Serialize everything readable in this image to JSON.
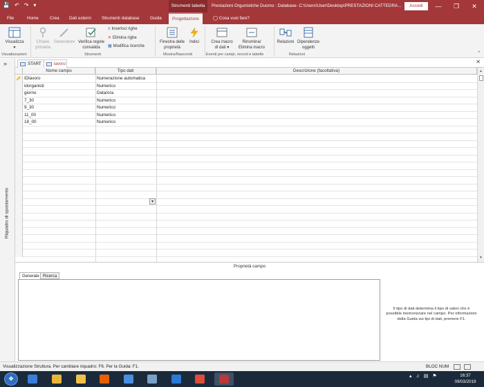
{
  "titlebar": {
    "qat_icons": [
      "save-icon",
      "undo-icon",
      "redo-icon",
      "customize-icon"
    ],
    "context_label": "Strumenti tabella",
    "title": "Prestazioni Orgunistiche Duomo : Database- C:\\Users\\User\\Desktop\\PRESTAZIONI CATTEDRA...",
    "login": "Accedi",
    "controls": [
      "?",
      "—",
      "❐",
      "✕"
    ]
  },
  "ribbon_tabs": {
    "items": [
      "File",
      "Home",
      "Crea",
      "Dati esterni",
      "Strumenti database",
      "Guida",
      "Progettazione"
    ],
    "active": "Progettazione",
    "tell_me": "Cosa vuoi fare?"
  },
  "ribbon": {
    "visualizza": {
      "label": "Visualizza"
    },
    "chiave_primaria": {
      "label_1": "Chiave",
      "label_2": "primaria"
    },
    "generatore": {
      "label": "Generatore"
    },
    "verifica": {
      "label_1": "Verifica regole",
      "label_2": "convalida"
    },
    "inserisci_righe": "Inserisci righe",
    "elimina_righe": "Elimina righe",
    "modifica_ricerche": "Modifica ricerche",
    "finestra": {
      "label_1": "Finestra delle",
      "label_2": "proprietà"
    },
    "indici": {
      "label": "Indici"
    },
    "crea_macro": {
      "label_1": "Crea macro",
      "label_2": "di dati ▾"
    },
    "rinomina": {
      "label_1": "Rinomina/",
      "label_2": "Elimina macro"
    },
    "relazioni": {
      "label": "Relazioni"
    },
    "dipendenze": {
      "label_1": "Dipendenze",
      "label_2": "oggetti"
    },
    "groups": {
      "visualizzazioni": "Visualizzazioni",
      "strumenti": "Strumenti",
      "mostra": "Mostra/Nascondi",
      "eventi": "Eventi per campi, record e tabelle",
      "relazioni": "Relazioni"
    }
  },
  "nav_pane": {
    "label": "Riquadro di spostamento",
    "toggle": "»"
  },
  "doc_tabs": [
    {
      "label": "START"
    },
    {
      "label": "lavoro"
    }
  ],
  "grid": {
    "headers": {
      "nome": "Nome campo",
      "tipo": "Tipo dati",
      "descrizione": "Descrizione (facoltativa)"
    },
    "rows": [
      {
        "key": true,
        "nome": "IDlavoro",
        "tipo": "Numerazione automatica"
      },
      {
        "key": false,
        "nome": "idorganisti",
        "tipo": "Numerico"
      },
      {
        "key": false,
        "nome": "giorno",
        "tipo": "Data/ora"
      },
      {
        "key": false,
        "nome": "7_30",
        "tipo": "Numerico"
      },
      {
        "key": false,
        "nome": "9_30",
        "tipo": "Numerico"
      },
      {
        "key": false,
        "nome": "11_00",
        "tipo": "Numerico"
      },
      {
        "key": false,
        "nome": "18_00",
        "tipo": "Numerico"
      }
    ]
  },
  "properties": {
    "title": "Proprietà campo",
    "tabs": [
      "Generale",
      "Ricerca"
    ],
    "help": "Il tipo di dati determina il tipo di valori che è possibile memorizzare nel campo. Per informazioni della Guida sui tipi di dati, premere F1."
  },
  "statusbar": {
    "message": "Visualizzazione Struttura. Per cambiare riquadro: F6. Per la Guida: F1.",
    "num_lock": "BLOC NUM"
  },
  "taskbar": {
    "apps": [
      {
        "name": "ie-icon",
        "color": "#3b7dd8"
      },
      {
        "name": "explorer-icon",
        "color": "#e8b53a"
      },
      {
        "name": "folder-icon",
        "color": "#f0c14a"
      },
      {
        "name": "firefox-icon",
        "color": "#e66000"
      },
      {
        "name": "media-icon",
        "color": "#4a8ee0"
      },
      {
        "name": "calc-icon",
        "color": "#7aa0c8"
      },
      {
        "name": "edge-icon",
        "color": "#2a7ad8"
      },
      {
        "name": "chrome-icon",
        "color": "#dd4b39"
      },
      {
        "name": "access-icon",
        "color": "#b7383b"
      }
    ],
    "time": "16:37",
    "date": "09/03/2019"
  }
}
